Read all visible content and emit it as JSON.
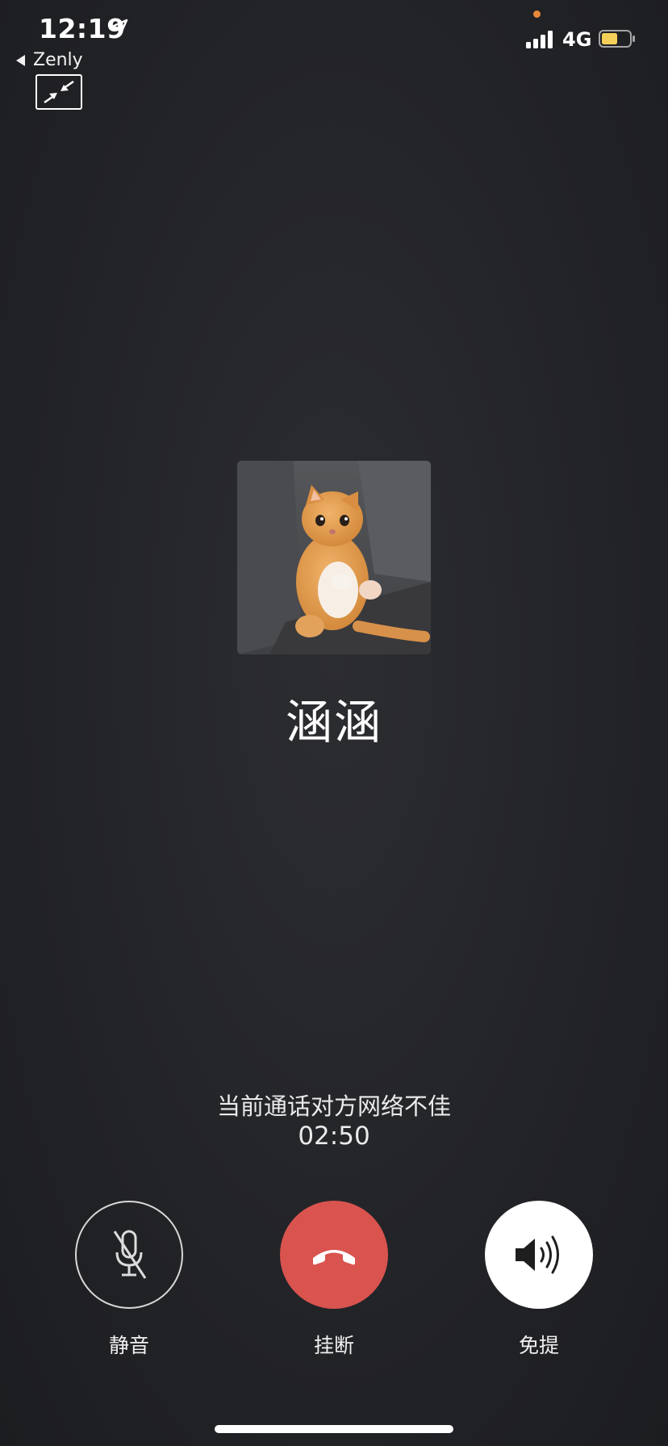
{
  "status_bar": {
    "time": "12:19",
    "back_app": "Zenly",
    "network": "4G"
  },
  "call": {
    "contact_name": "涵涵",
    "status_text": "当前通话对方网络不佳",
    "duration": "02:50"
  },
  "controls": {
    "mute_label": "静音",
    "hangup_label": "挂断",
    "speaker_label": "免提"
  },
  "colors": {
    "hangup": "#d9534f",
    "battery": "#f4d058",
    "background": "#232428"
  }
}
